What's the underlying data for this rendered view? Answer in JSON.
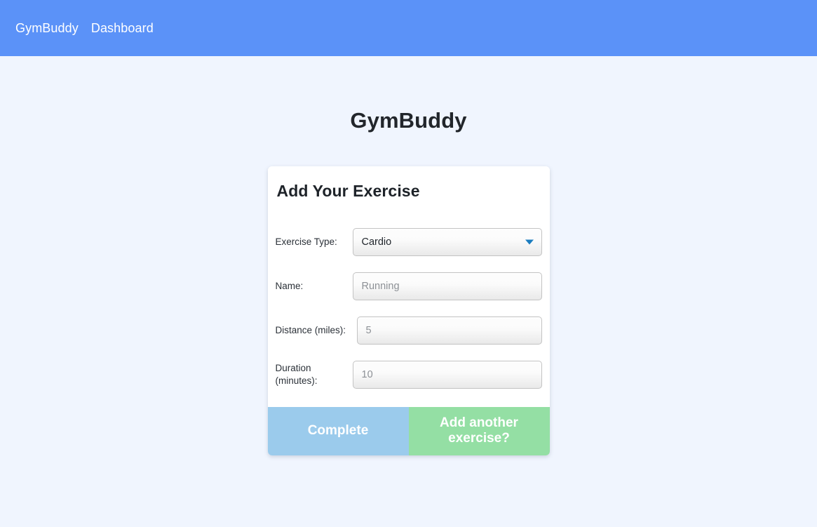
{
  "navbar": {
    "brand": "GymBuddy",
    "links": [
      {
        "label": "GymBuddy"
      },
      {
        "label": "Dashboard"
      }
    ],
    "background_color": "#5b92f8",
    "text_color": "#ffffff"
  },
  "page": {
    "title": "GymBuddy",
    "background_color": "#f0f5fe"
  },
  "card": {
    "title": "Add Your Exercise",
    "fields": [
      {
        "label": "Exercise Type:",
        "type": "select",
        "value": "Cardio",
        "icon": "chevron-down-icon",
        "arrow_color": "#1b7cbf"
      },
      {
        "label": "Name:",
        "type": "text",
        "value": "",
        "placeholder": "Running"
      },
      {
        "label": "Distance (miles):",
        "type": "number",
        "value": "",
        "placeholder": "5"
      },
      {
        "label": "Duration (minutes):",
        "type": "number",
        "value": "",
        "placeholder": "10"
      }
    ],
    "buttons": {
      "complete": {
        "label": "Complete",
        "color": "#9bcbec"
      },
      "add_another": {
        "label": "Add another exercise?",
        "color": "#94dfa4"
      }
    }
  }
}
